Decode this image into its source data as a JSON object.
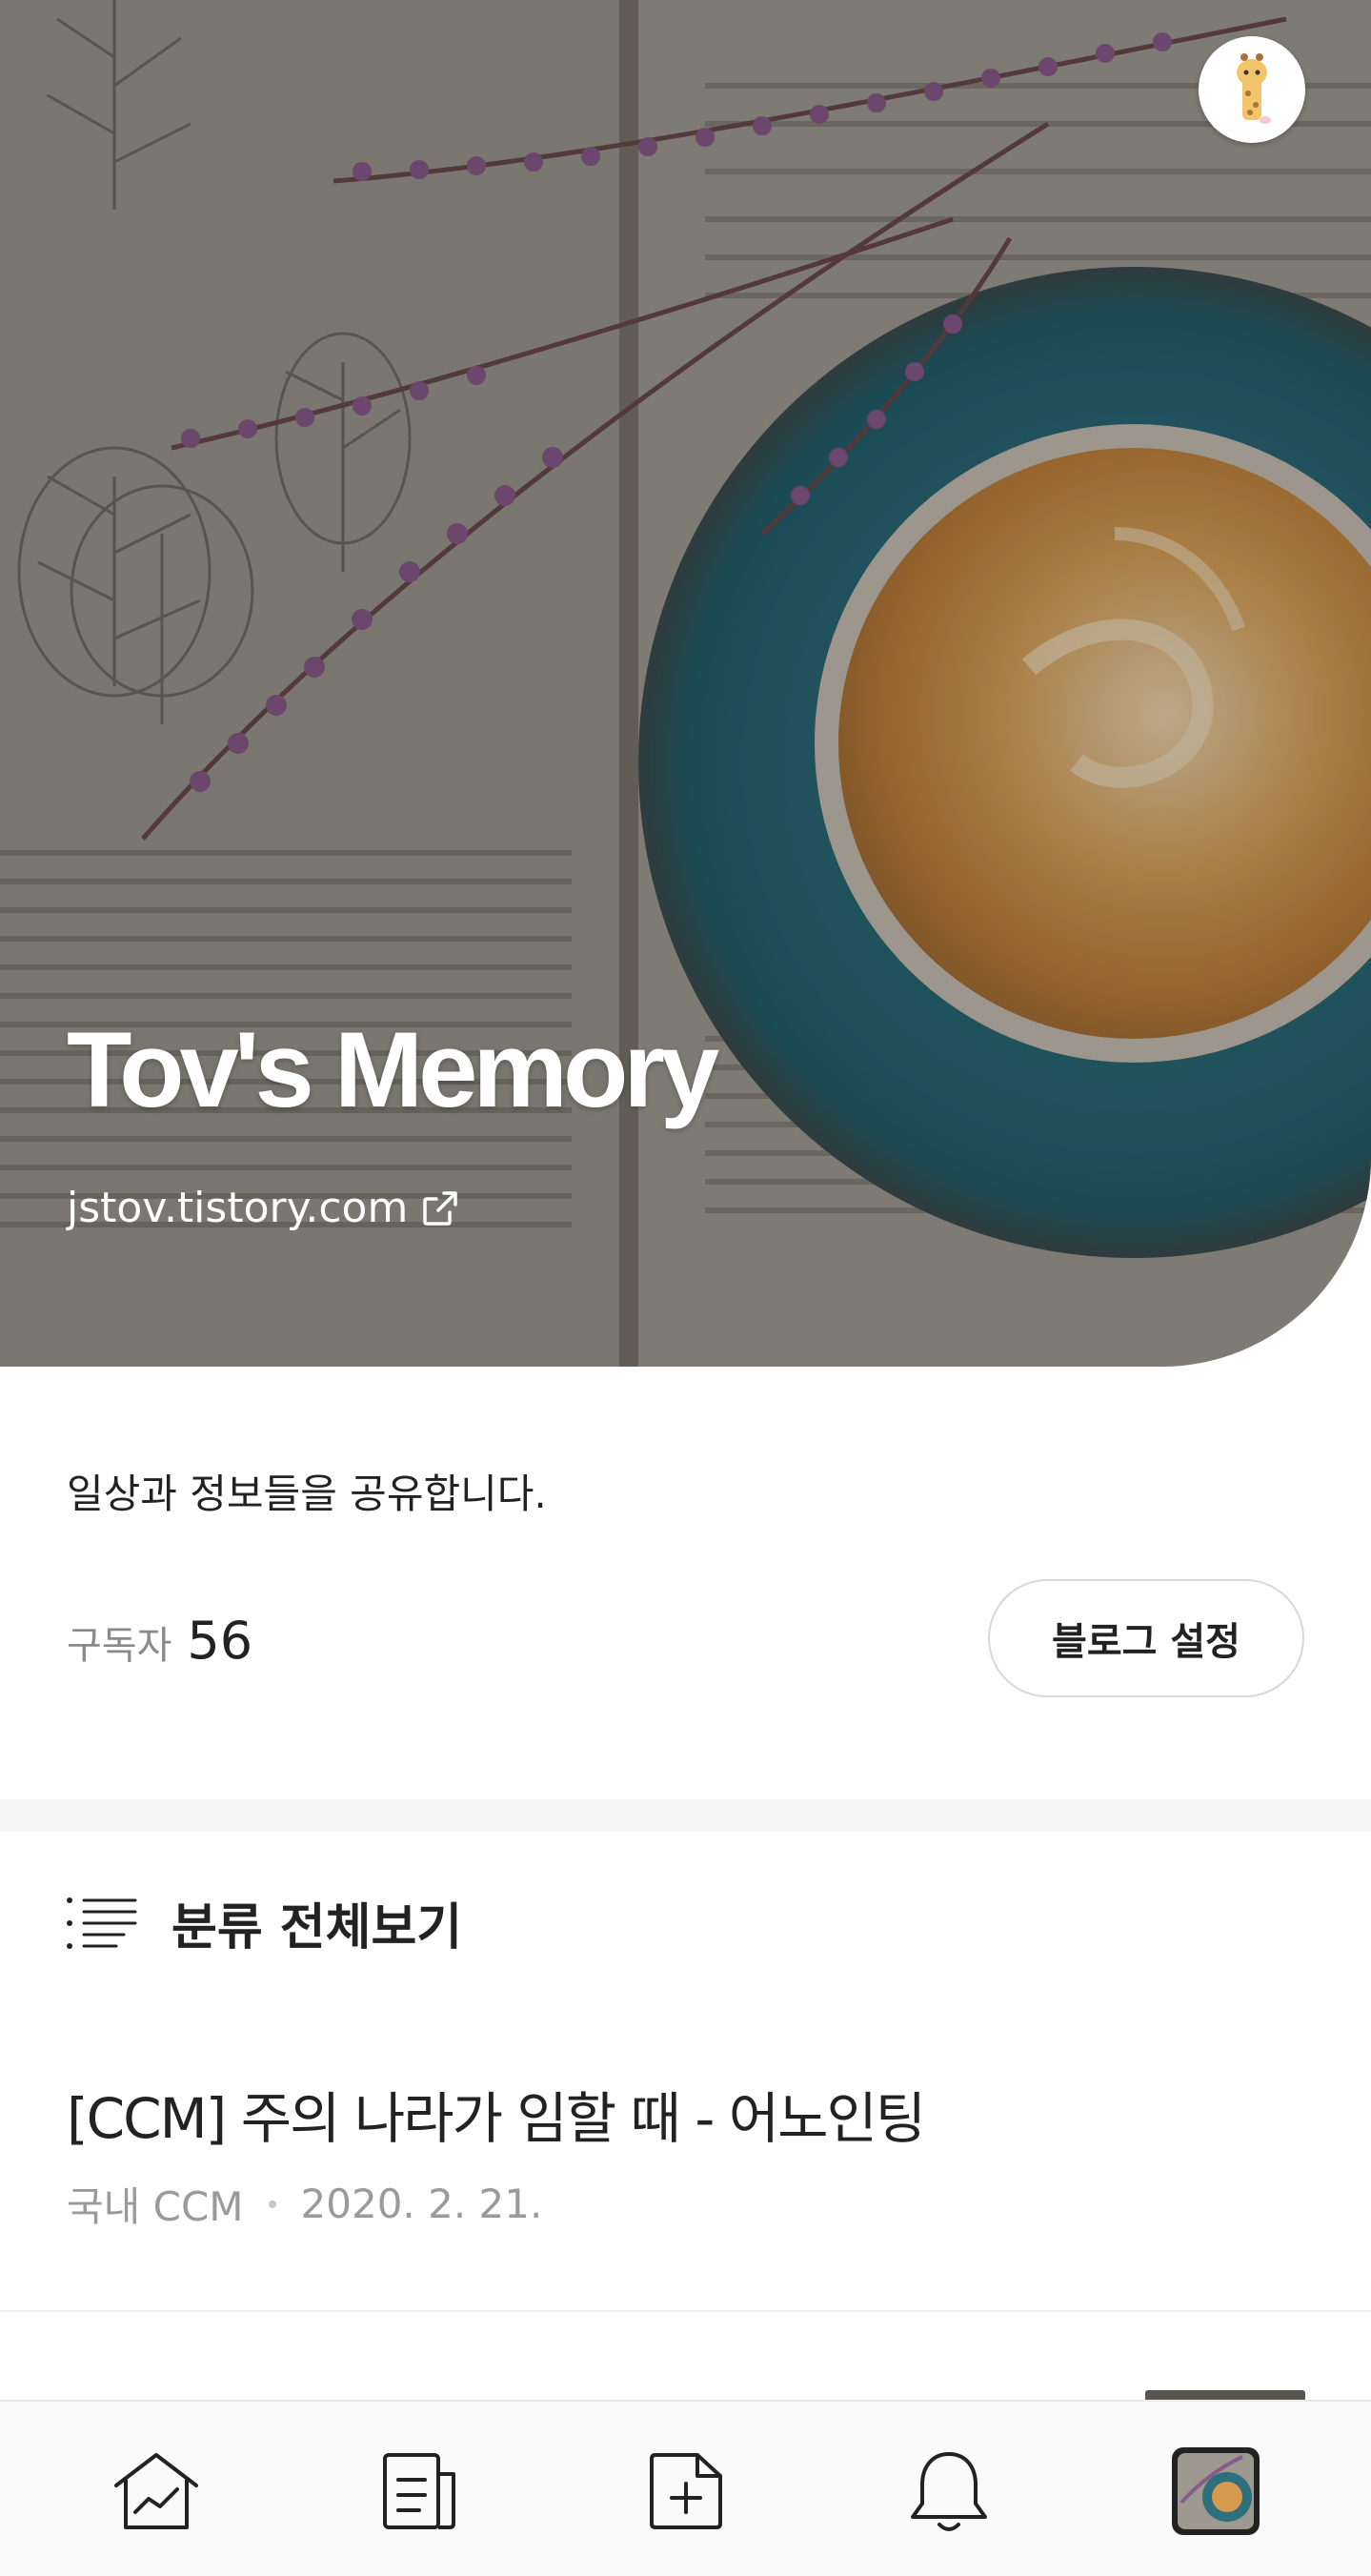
{
  "blog": {
    "title": "Tov's Memory",
    "url": "jstov.tistory.com",
    "description": "일상과 정보들을 공유합니다."
  },
  "subscribers": {
    "label": "구독자",
    "count": "56"
  },
  "settings_button": {
    "label": "블로그 설정"
  },
  "category": {
    "label": "분류 전체보기"
  },
  "posts": [
    {
      "title": "[CCM] 주의 나라가 임할 때 - 어노인팅",
      "category": "국내 CCM",
      "date": "2020. 2. 21."
    }
  ],
  "bottom_nav": {
    "items": [
      {
        "icon": "home-chart-icon"
      },
      {
        "icon": "document-icon"
      },
      {
        "icon": "new-post-icon"
      },
      {
        "icon": "bell-icon"
      },
      {
        "icon": "profile-thumbnail"
      }
    ]
  },
  "colors": {
    "saucer_blue": "#2e6f7c",
    "coffee_foam": "#d59a4d",
    "heather_purple": "#8a5a8c",
    "text_dark": "#222222",
    "text_muted": "#9a9a9a"
  }
}
